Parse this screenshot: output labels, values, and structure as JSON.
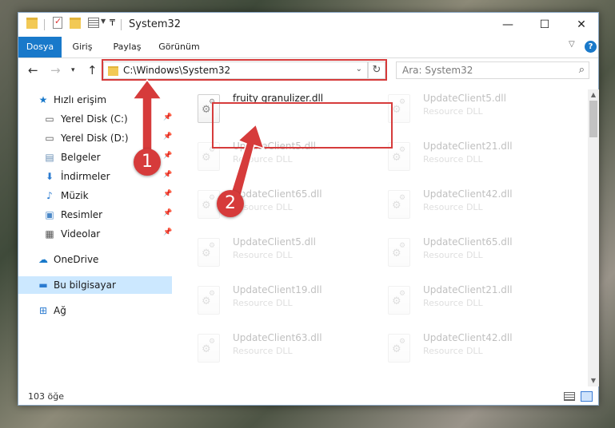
{
  "window": {
    "title": "System32",
    "minimize": "—",
    "maximize": "☐",
    "close": "✕"
  },
  "ribbon": {
    "tabs": [
      "Dosya",
      "Giriş",
      "Paylaş",
      "Görünüm"
    ],
    "help": "?"
  },
  "address_bar": {
    "path": "C:\\Windows\\System32"
  },
  "search": {
    "placeholder": "Ara: System32"
  },
  "nav_pane": {
    "quick_access": "Hızlı erişim",
    "pinned": [
      {
        "label": "Yerel Disk (C:)",
        "icon": "drive-icon"
      },
      {
        "label": "Yerel Disk (D:)",
        "icon": "drive-icon"
      },
      {
        "label": "Belgeler",
        "icon": "documents-icon"
      },
      {
        "label": "İndirmeler",
        "icon": "downloads-icon"
      },
      {
        "label": "Müzik",
        "icon": "music-icon"
      },
      {
        "label": "Resimler",
        "icon": "pictures-icon"
      },
      {
        "label": "Videolar",
        "icon": "videos-icon"
      }
    ],
    "onedrive": "OneDrive",
    "this_pc": "Bu bilgisayar",
    "network": "Ağ"
  },
  "files": [
    {
      "name": "fruity granulizer.dll",
      "type": "",
      "faded": false
    },
    {
      "name": "UpdateClient5.dll",
      "type": "Resource DLL",
      "faded": true
    },
    {
      "name": "UpdateClient5.dll",
      "type": "Resource DLL",
      "faded": true
    },
    {
      "name": "UpdateClient21.dll",
      "type": "Resource DLL",
      "faded": true
    },
    {
      "name": "UpdateClient65.dll",
      "type": "Resource DLL",
      "faded": true
    },
    {
      "name": "UpdateClient42.dll",
      "type": "Resource DLL",
      "faded": true
    },
    {
      "name": "UpdateClient5.dll",
      "type": "Resource DLL",
      "faded": true
    },
    {
      "name": "UpdateClient65.dll",
      "type": "Resource DLL",
      "faded": true
    },
    {
      "name": "UpdateClient19.dll",
      "type": "Resource DLL",
      "faded": true
    },
    {
      "name": "UpdateClient21.dll",
      "type": "Resource DLL",
      "faded": true
    },
    {
      "name": "UpdateClient63.dll",
      "type": "Resource DLL",
      "faded": true
    },
    {
      "name": "UpdateClient42.dll",
      "type": "Resource DLL",
      "faded": true
    }
  ],
  "status": {
    "item_count": "103 öğe"
  },
  "callouts": [
    "1",
    "2"
  ],
  "colors": {
    "accent": "#1979ca",
    "highlight": "#d63b3b",
    "selection": "#cce8ff"
  }
}
